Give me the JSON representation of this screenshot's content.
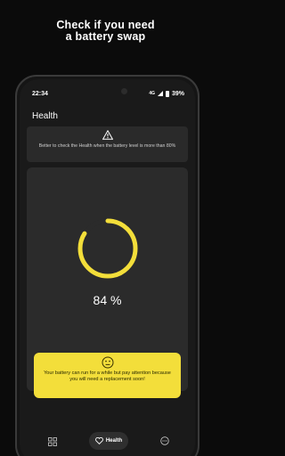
{
  "promo": {
    "line1": "Check if you need",
    "line2": "a battery swap"
  },
  "status_bar": {
    "time": "22:34",
    "network": "4G",
    "battery": "39%"
  },
  "app": {
    "title": "Health"
  },
  "warning": {
    "text": "Better to check the Health when the battery level is more than 80%"
  },
  "health": {
    "percent_text": "84 %",
    "value": 84
  },
  "advice": {
    "text": "Your battery can run for a while but pay attention because you will need a replacement soon!"
  },
  "bottom_nav": {
    "left_icon": "grid-icon",
    "center_icon": "heart-icon",
    "center_label": "Health",
    "right_icon": "more-icon"
  },
  "colors": {
    "accent": "#f3de3a",
    "background": "#1a1a1a",
    "card": "#2b2b2b"
  }
}
